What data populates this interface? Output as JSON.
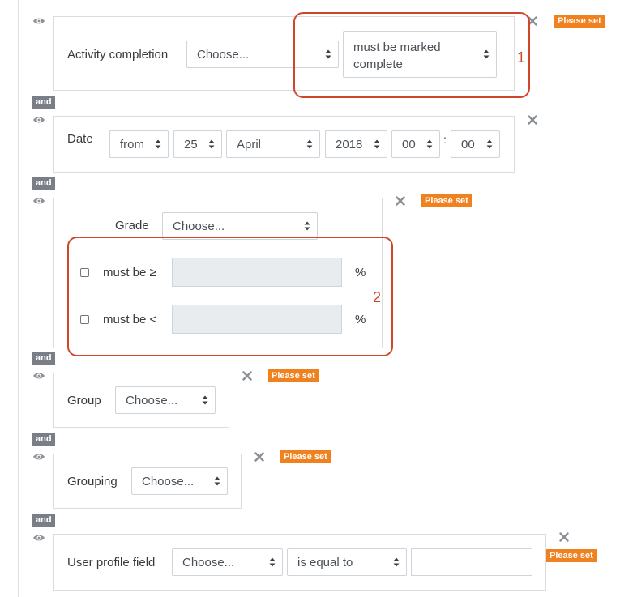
{
  "colors": {
    "badge": "#f0811f",
    "and_badge": "#7a7f87",
    "annotation": "#d0462b"
  },
  "icons": {
    "visibility": "eye-icon",
    "delete": "close-icon",
    "select": "select-arrows-icon"
  },
  "and_label": "and",
  "please_set": "Please set",
  "conditions": {
    "activity": {
      "label": "Activity completion",
      "activity_select": "Choose...",
      "state_select": "must be marked complete"
    },
    "date": {
      "label": "Date",
      "direction": "from",
      "day": "25",
      "month": "April",
      "year": "2018",
      "hour": "00",
      "minute": "00",
      "separator": ":"
    },
    "grade": {
      "label": "Grade",
      "item_select": "Choose...",
      "min_label": "must be ≥",
      "max_label": "must be <",
      "min_value": "",
      "max_value": "",
      "unit": "%"
    },
    "group": {
      "label": "Group",
      "select": "Choose..."
    },
    "grouping": {
      "label": "Grouping",
      "select": "Choose..."
    },
    "profile": {
      "label": "User profile field",
      "field_select": "Choose...",
      "operator_select": "is equal to",
      "value": ""
    }
  },
  "annotations": {
    "one": "1",
    "two": "2"
  }
}
